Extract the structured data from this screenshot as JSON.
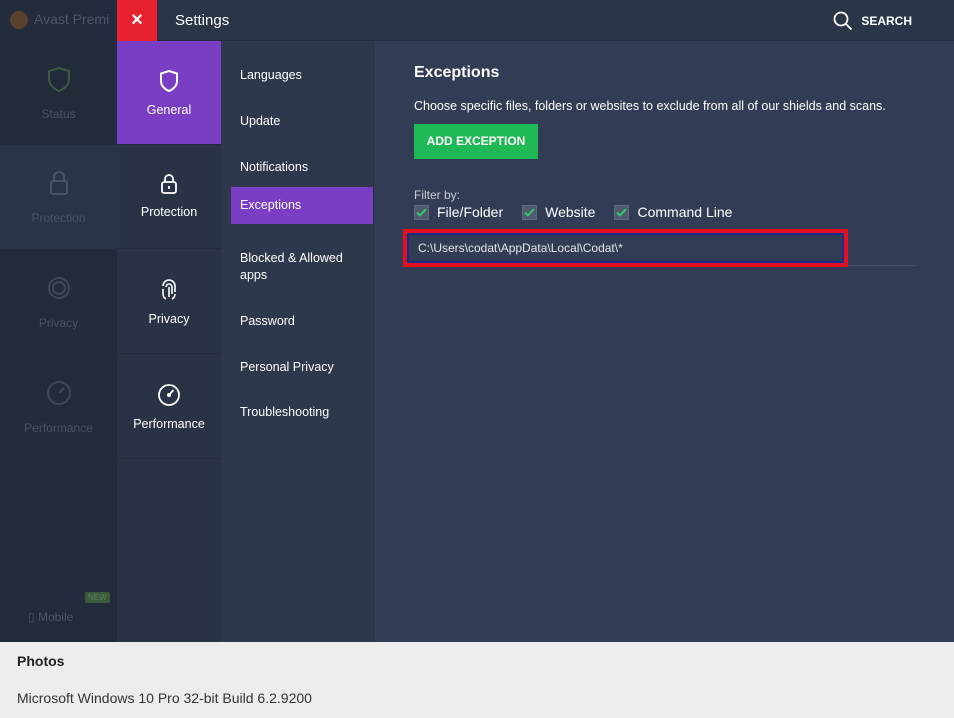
{
  "background_app": {
    "title": "Avast Premi",
    "items": [
      {
        "label": "Status"
      },
      {
        "label": "Protection"
      },
      {
        "label": "Privacy"
      },
      {
        "label": "Performance"
      }
    ],
    "mobile_label": "Mobile",
    "new_badge": "NEW"
  },
  "settings": {
    "title": "Settings",
    "close_label": "×",
    "search_label": "SEARCH",
    "categories": [
      {
        "label": "General",
        "icon": "shield-icon"
      },
      {
        "label": "Protection",
        "icon": "lock-icon"
      },
      {
        "label": "Privacy",
        "icon": "fingerprint-icon"
      },
      {
        "label": "Performance",
        "icon": "gauge-icon"
      }
    ],
    "submenu": [
      {
        "label": "Languages"
      },
      {
        "label": "Update"
      },
      {
        "label": "Notifications"
      },
      {
        "label": "Exceptions"
      },
      {
        "label": "Blocked & Allowed apps"
      },
      {
        "label": "Password"
      },
      {
        "label": "Personal Privacy"
      },
      {
        "label": "Troubleshooting"
      }
    ],
    "selected_category": "General",
    "selected_submenu": "Exceptions"
  },
  "exceptions": {
    "title": "Exceptions",
    "description": "Choose specific files, folders or websites to exclude from all of our shields and scans.",
    "add_button": "ADD EXCEPTION",
    "filter_label": "Filter by:",
    "filters": [
      {
        "label": "File/Folder",
        "checked": true
      },
      {
        "label": "Website",
        "checked": true
      },
      {
        "label": "Command Line",
        "checked": true
      }
    ],
    "entries": [
      {
        "path": "C:\\Users\\codat\\AppData\\Local\\Codat\\*"
      }
    ]
  },
  "footer": {
    "title": "Photos",
    "subtitle": "Microsoft Windows 10 Pro 32-bit Build 6.2.9200"
  },
  "colors": {
    "accent_purple": "#7a3ec4",
    "close_red": "#e8212f",
    "add_green": "#1eb854",
    "highlight_red": "#e01020"
  }
}
